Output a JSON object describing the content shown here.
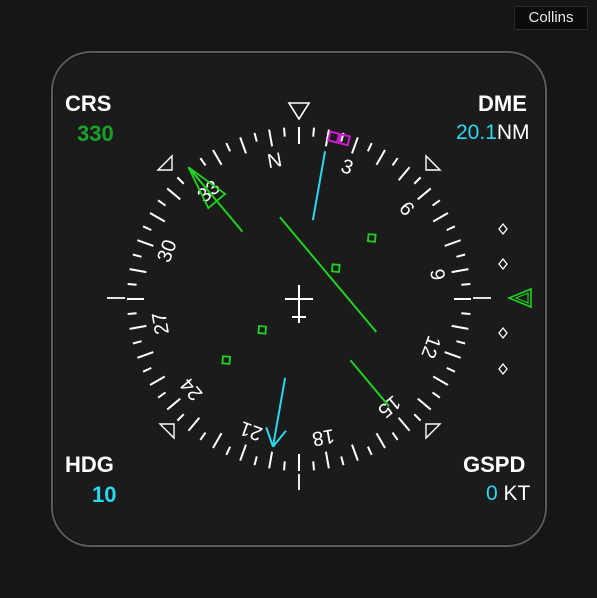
{
  "brand": "Collins",
  "crs": {
    "label": "CRS",
    "value": "330",
    "color": "#1aa12a"
  },
  "dme": {
    "label": "DME",
    "value": "20.1",
    "unit": "NM",
    "color": "#29d8f0"
  },
  "hdg": {
    "label": "HDG",
    "value": "10",
    "color": "#29d8f0"
  },
  "gspd": {
    "label": "GSPD",
    "value": "0",
    "unit": "KT",
    "color": "#29d8f0"
  },
  "compass": {
    "heading_deg": 10,
    "course_deg": 330,
    "bearing_pointer_deg": 200,
    "cardinal_labels": [
      "N",
      "3",
      "6",
      "9",
      "12",
      "15",
      "18",
      "21",
      "24",
      "27",
      "30",
      "33"
    ],
    "needle_color": "#1fd21f",
    "bug_color": "#d01ad0",
    "pointer_color": "#29d8f0"
  }
}
